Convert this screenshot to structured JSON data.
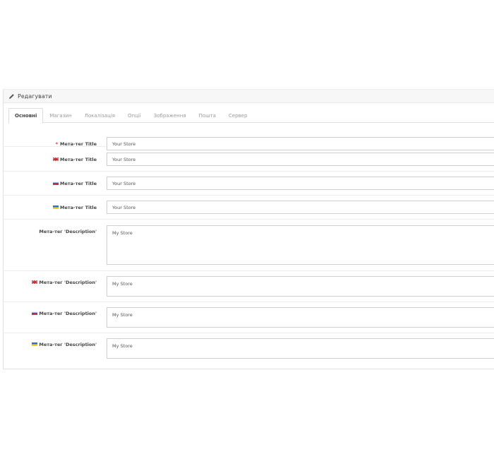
{
  "panel": {
    "title": "Редагувати",
    "tabs": [
      {
        "label": "Основні",
        "active": true
      },
      {
        "label": "Магазин"
      },
      {
        "label": "Локалізація"
      },
      {
        "label": "Опції"
      },
      {
        "label": "Зображення"
      },
      {
        "label": "Пошта"
      },
      {
        "label": "Сервер"
      }
    ]
  },
  "form": {
    "meta_title": {
      "label": "Мета-тег Title",
      "required": true,
      "value": "Your Store"
    },
    "meta_title_en": {
      "label": "Мета-тег Title",
      "flag": "flag-uk-icon",
      "value": "Your Store"
    },
    "meta_title_ru": {
      "label": "Мета-тег Title",
      "flag": "flag-ru-icon",
      "value": "Your Store"
    },
    "meta_title_ua": {
      "label": "Мета-тег Title",
      "flag": "flag-ua-icon",
      "value": "Your Store"
    },
    "meta_description": {
      "label": "Мета-тег 'Description'",
      "value": "My Store"
    },
    "meta_description_en": {
      "label": "Мета-тег 'Description'",
      "flag": "flag-uk-icon",
      "value": "My Store"
    },
    "meta_description_ru": {
      "label": "Мета-тег 'Description'",
      "flag": "flag-ru-icon",
      "value": "My Store"
    },
    "meta_description_ua": {
      "label": "Мета-тег 'Description'",
      "flag": "flag-ua-icon",
      "value": "My Store"
    }
  },
  "colors": {
    "required": "#ee2222",
    "tab_active": "#444444",
    "tab_inactive": "#9a9a9a"
  }
}
